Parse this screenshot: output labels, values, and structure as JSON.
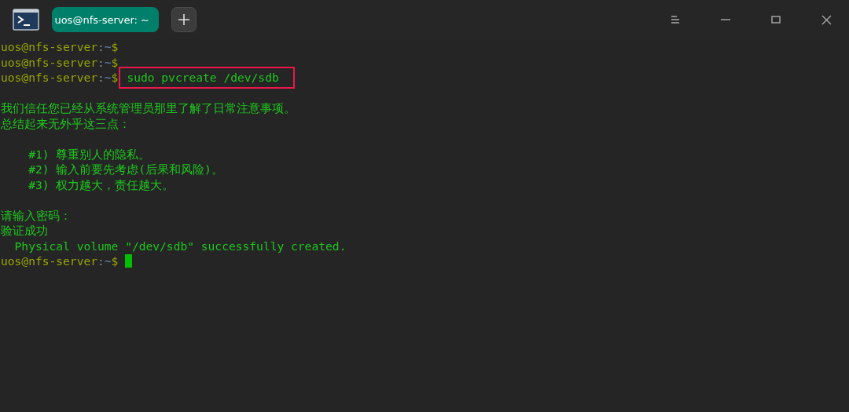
{
  "tabs": [
    {
      "label": "uos@nfs-server: ~",
      "selected": true
    }
  ],
  "terminal": {
    "lines": [
      {
        "kind": "prompt",
        "user_host": "uos@nfs-server",
        "separator": ":",
        "path": "~",
        "symbol": "$"
      },
      {
        "kind": "prompt",
        "user_host": "uos@nfs-server",
        "separator": ":",
        "path": "~",
        "symbol": "$"
      },
      {
        "kind": "prompt",
        "user_host": "uos@nfs-server",
        "separator": ":",
        "path": "~",
        "symbol": "$",
        "command": "sudo pvcreate /dev/sdb",
        "highlighted": true
      },
      {
        "kind": "blank"
      },
      {
        "kind": "output",
        "text": "我们信任您已经从系统管理员那里了解了日常注意事项。"
      },
      {
        "kind": "output",
        "text": "总结起来无外乎这三点："
      },
      {
        "kind": "blank"
      },
      {
        "kind": "output",
        "text": "    #1) 尊重别人的隐私。"
      },
      {
        "kind": "output",
        "text": "    #2) 输入前要先考虑(后果和风险)。"
      },
      {
        "kind": "output",
        "text": "    #3) 权力越大，责任越大。"
      },
      {
        "kind": "blank"
      },
      {
        "kind": "output",
        "text": "请输入密码："
      },
      {
        "kind": "output",
        "text": "验证成功"
      },
      {
        "kind": "output",
        "text": "  Physical volume \"/dev/sdb\" successfully created."
      },
      {
        "kind": "prompt",
        "user_host": "uos@nfs-server",
        "separator": ":",
        "path": "~",
        "symbol": "$",
        "cursor": true
      }
    ]
  }
}
